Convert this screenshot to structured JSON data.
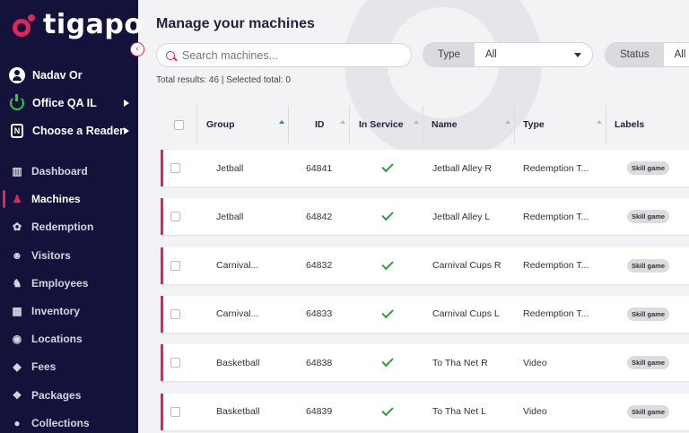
{
  "app": {
    "logo_text": "tigapo",
    "collapse_glyph": "‹"
  },
  "sidebar": {
    "user": {
      "name": "Nadav Or",
      "icon": "user-icon"
    },
    "site": {
      "name": "Office QA IL",
      "icon": "power-icon"
    },
    "reader": {
      "name": "Choose a Reader",
      "icon": "nfc-icon"
    },
    "nav": [
      {
        "label": "Dashboard",
        "icon": "bar-chart-icon",
        "glyph": "▥"
      },
      {
        "label": "Machines",
        "icon": "user-icon",
        "glyph": "♟"
      },
      {
        "label": "Redemption",
        "icon": "gift-icon",
        "glyph": "✿"
      },
      {
        "label": "Visitors",
        "icon": "group-icon",
        "glyph": "☻"
      },
      {
        "label": "Employees",
        "icon": "employee-icon",
        "glyph": "♞"
      },
      {
        "label": "Inventory",
        "icon": "inventory-icon",
        "glyph": "▦"
      },
      {
        "label": "Locations",
        "icon": "location-icon",
        "glyph": "◉"
      },
      {
        "label": "Fees",
        "icon": "tag-icon",
        "glyph": "◆"
      },
      {
        "label": "Packages",
        "icon": "package-icon",
        "glyph": "❖"
      },
      {
        "label": "Collections",
        "icon": "coin-icon",
        "glyph": "●"
      }
    ],
    "active": "Machines"
  },
  "main": {
    "title": "Manage your machines",
    "search": {
      "placeholder": "Search machines..."
    },
    "filters": [
      {
        "label": "Type",
        "value": "All"
      },
      {
        "label": "Status",
        "value": "All"
      }
    ],
    "results_text": "Total results: 46 | Selected total: 0",
    "columns": [
      "Group",
      "ID",
      "In Service",
      "Name",
      "Type",
      "Labels"
    ],
    "rows": [
      {
        "group": "Jetball",
        "id": "64841",
        "in_service": true,
        "name": "Jetball Alley R",
        "type": "Redemption T...",
        "label": "Skill game"
      },
      {
        "group": "Jetball",
        "id": "64842",
        "in_service": true,
        "name": "Jetball Alley L",
        "type": "Redemption T...",
        "label": "Skill game"
      },
      {
        "group": "Carnival...",
        "id": "64832",
        "in_service": true,
        "name": "Carnival Cups R",
        "type": "Redemption T...",
        "label": "Skill game"
      },
      {
        "group": "Carnival...",
        "id": "64833",
        "in_service": true,
        "name": "Carnival Cups L",
        "type": "Redemption T...",
        "label": "Skill game"
      },
      {
        "group": "Basketball",
        "id": "64838",
        "in_service": true,
        "name": "To Tha Net R",
        "type": "Video",
        "label": "Skill game"
      },
      {
        "group": "Basketball",
        "id": "64839",
        "in_service": true,
        "name": "To Tha Net L",
        "type": "Video",
        "label": "Skill game"
      }
    ]
  },
  "colors": {
    "sidebar_bg": "#12123a",
    "accent": "#e0245e",
    "success": "#2e9e44"
  }
}
